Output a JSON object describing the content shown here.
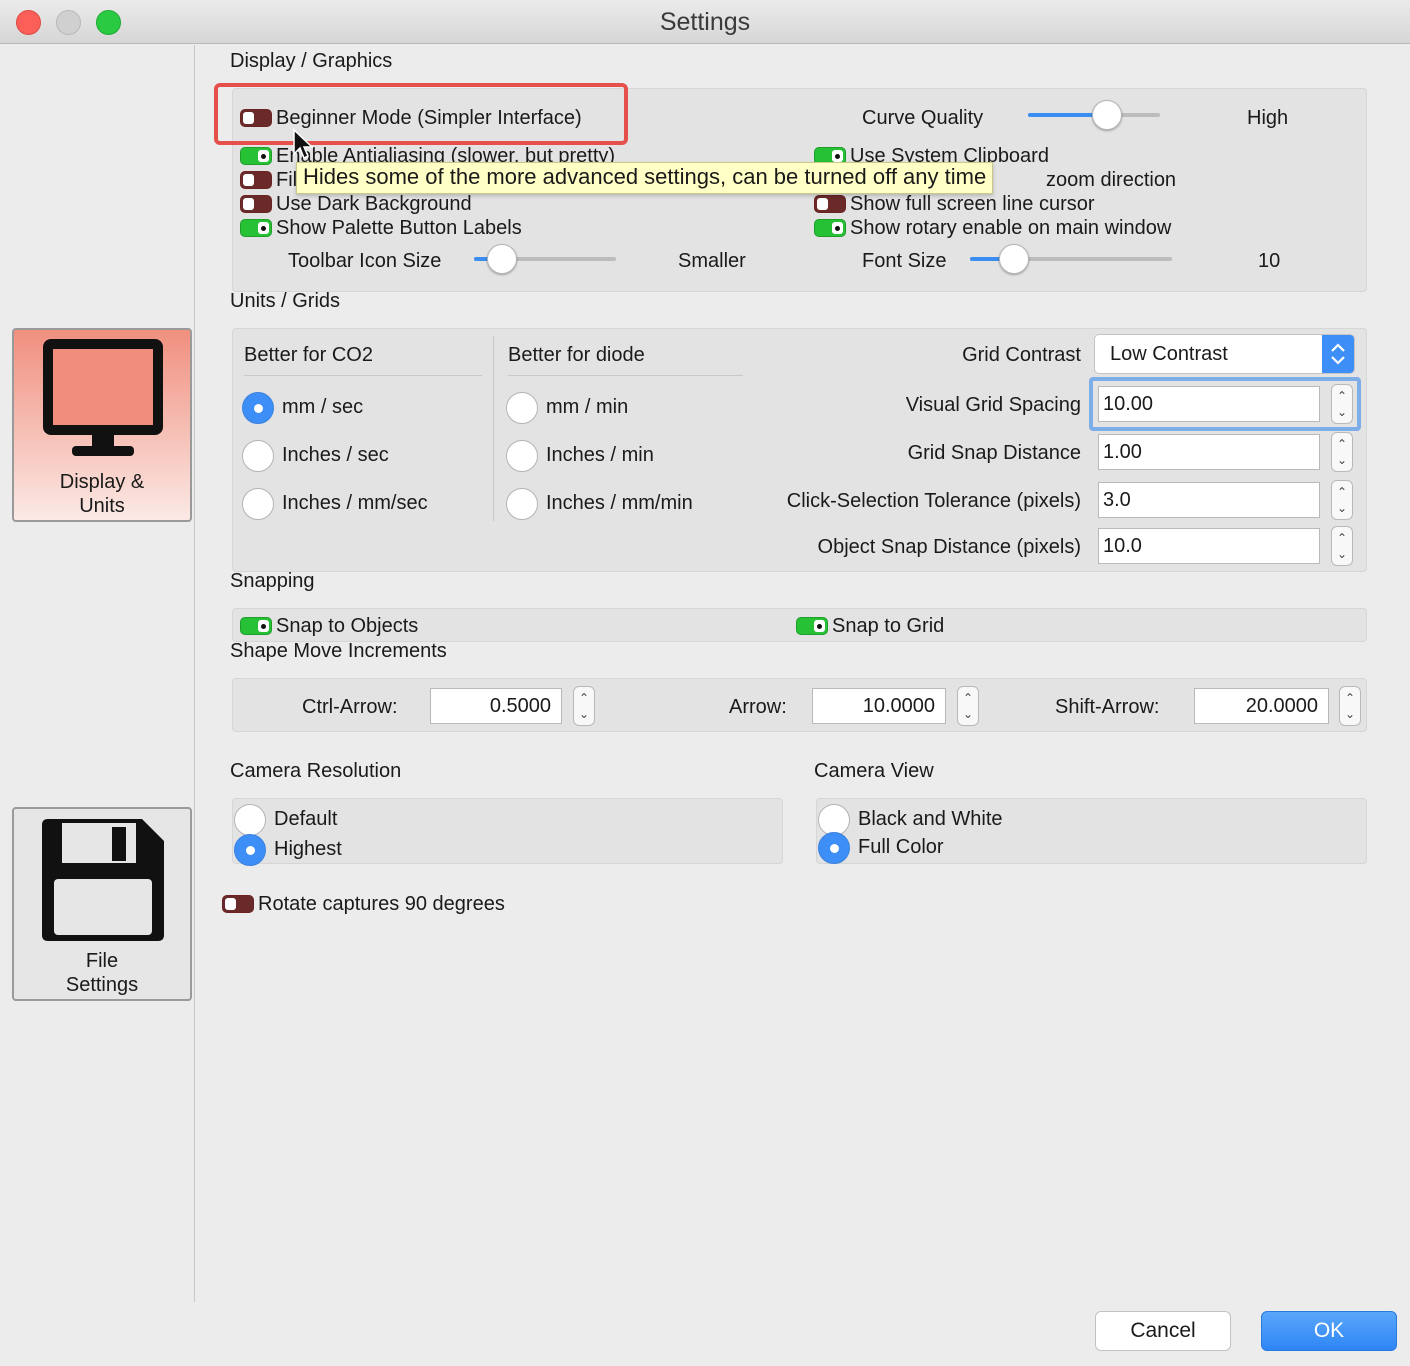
{
  "window": {
    "title": "Settings"
  },
  "sidebar": [
    {
      "label_line1": "Display &",
      "label_line2": "Units",
      "icon": "monitor-icon",
      "active": true
    },
    {
      "label_line1": "File",
      "label_line2": "Settings",
      "icon": "floppy-disk-icon",
      "active": false
    }
  ],
  "display_graphics": {
    "title": "Display / Graphics",
    "beginner_mode": {
      "label": "Beginner Mode (Simpler Interface)",
      "on": false
    },
    "antialiasing": {
      "label": "Enable Antialiasing (slower, but pretty)",
      "on": true
    },
    "fi_partial": {
      "label": "Fil",
      "on": false
    },
    "dark_background": {
      "label": "Use Dark Background",
      "on": false
    },
    "palette_labels": {
      "label": "Show Palette Button Labels",
      "on": true
    },
    "curve_quality": {
      "label": "Curve Quality",
      "value_label": "High",
      "level": 0.6
    },
    "system_clipboard": {
      "label": "Use System Clipboard",
      "on": true
    },
    "zoom_direction": {
      "label": "zoom direction"
    },
    "fullscreen_cursor": {
      "label": "Show full screen line cursor",
      "on": false
    },
    "rotary_enable": {
      "label": "Show rotary enable on main window",
      "on": true
    },
    "toolbar_icon_size": {
      "label": "Toolbar Icon Size",
      "value_label": "Smaller",
      "level": 0.2
    },
    "font_size": {
      "label": "Font Size",
      "value_label": "10",
      "level": 0.22
    },
    "tooltip": "Hides some of the more advanced settings, can be turned off any time"
  },
  "units_grids": {
    "title": "Units / Grids",
    "co2": {
      "header": "Better for CO2",
      "options": [
        "mm / sec",
        "Inches / sec",
        "Inches / mm/sec"
      ],
      "selected": 0
    },
    "diode": {
      "header": "Better for diode",
      "options": [
        "mm / min",
        "Inches / min",
        "Inches / mm/min"
      ],
      "selected": -1
    },
    "grid_contrast": {
      "label": "Grid Contrast",
      "value": "Low Contrast"
    },
    "visual_grid_spacing": {
      "label": "Visual Grid Spacing",
      "value": "10.00"
    },
    "grid_snap_distance": {
      "label": "Grid Snap Distance",
      "value": "1.00"
    },
    "click_tolerance": {
      "label": "Click-Selection Tolerance (pixels)",
      "value": "3.0"
    },
    "object_snap": {
      "label": "Object Snap Distance (pixels)",
      "value": "10.0"
    }
  },
  "snapping": {
    "title": "Snapping",
    "snap_objects": {
      "label": "Snap to Objects",
      "on": true
    },
    "snap_grid": {
      "label": "Snap to Grid",
      "on": true
    }
  },
  "shape_move": {
    "title": "Shape Move Increments",
    "ctrl_arrow": {
      "label": "Ctrl-Arrow:",
      "value": "0.5000"
    },
    "arrow": {
      "label": "Arrow:",
      "value": "10.0000"
    },
    "shift_arrow": {
      "label": "Shift-Arrow:",
      "value": "20.0000"
    }
  },
  "camera_resolution": {
    "title": "Camera Resolution",
    "options": [
      "Default",
      "Highest"
    ],
    "selected": 1
  },
  "camera_view": {
    "title": "Camera View",
    "options": [
      "Black and White",
      "Full Color"
    ],
    "selected": 1
  },
  "rotate_captures": {
    "label": "Rotate captures 90 degrees",
    "on": false
  },
  "footer": {
    "cancel": "Cancel",
    "ok": "OK"
  },
  "colors": {
    "accent": "#3d8ef6",
    "toggle_on": "#27c136",
    "toggle_off": "#6a2a2a",
    "highlight": "#e5504a",
    "tooltip_bg": "#ffffc6"
  }
}
